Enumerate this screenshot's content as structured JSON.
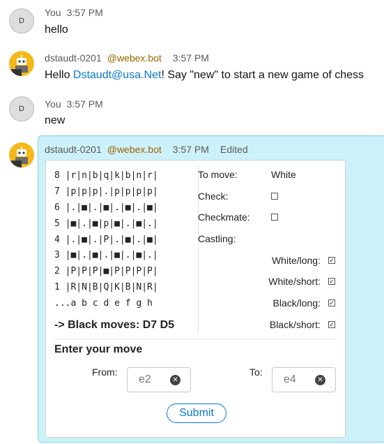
{
  "messages": [
    {
      "sender": "You",
      "time": "3:57 PM",
      "avatar_initial": "D",
      "text": "hello"
    },
    {
      "sender": "dstaudt-0201",
      "mention": "@webex.bot",
      "time": "3:57 PM",
      "text_before": "Hello ",
      "link": "Dstaudt@usa.Net",
      "text_after": "!  Say \"new\" to start a new game of chess"
    },
    {
      "sender": "You",
      "time": "3:57 PM",
      "avatar_initial": "D",
      "text": "new"
    },
    {
      "sender": "dstaudt-0201",
      "mention": "@webex.bot",
      "time": "3:57 PM",
      "edited": "Edited"
    }
  ],
  "card": {
    "board_lines": [
      "8 |r|n|b|q|k|b|n|r|",
      "7 |p|p|p|.|p|p|p|p|",
      "6 |.|■|.|■|.|■|.|■|",
      "5 |■|.|■|p|■|.|■|.|",
      "4 |.|■|.|P|.|■|.|■|",
      "3 |■|.|■|.|■|.|■|.|",
      "2 |P|P|P|■|P|P|P|P|",
      "1 |R|N|B|Q|K|B|N|R|",
      "...a b c d e f g h"
    ],
    "last_move": "-> Black moves: D7 D5",
    "to_move_label": "To move:",
    "to_move_value": "White",
    "check_label": "Check:",
    "check_checked": false,
    "checkmate_label": "Checkmate:",
    "checkmate_checked": false,
    "castling_label": "Castling:",
    "castling": [
      {
        "label": "White/long:",
        "checked": true
      },
      {
        "label": "White/short:",
        "checked": true
      },
      {
        "label": "Black/long:",
        "checked": true
      },
      {
        "label": "Black/short:",
        "checked": true
      }
    ],
    "enter_move_title": "Enter your move",
    "from_label": "From:",
    "from_placeholder": "e2",
    "to_label": "To:",
    "to_placeholder": "e4",
    "submit_label": "Submit",
    "check_mark": "✓",
    "clear_glyph": "✕"
  },
  "colors": {
    "link": "#0a78cc",
    "mention": "#9b6400",
    "card_highlight": "#cdf1f9",
    "bot_avatar": "#f5b81b"
  }
}
